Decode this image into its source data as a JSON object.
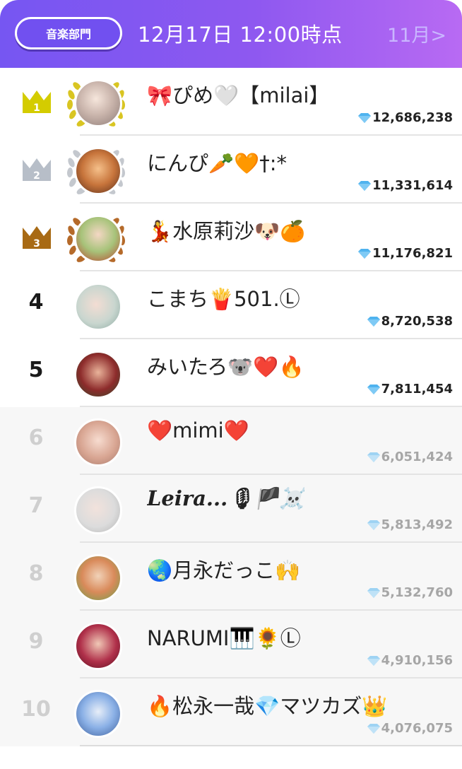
{
  "header": {
    "category_label": "音楽部門",
    "date_title": "12月17日 12:00時点",
    "month_link": "11月>"
  },
  "colors": {
    "header_gradient_start": "#7656f2",
    "header_gradient_end": "#b86af3",
    "gold": "#d4cc00",
    "silver": "#b7bec8",
    "bronze": "#a86a14",
    "gem": "#4fb3ef"
  },
  "rankings": [
    {
      "rank": "1",
      "name": "🎀ぴめ🤍【milai】",
      "score": "12,686,238",
      "badge": "gold-crown",
      "avatar": "avatar-photo"
    },
    {
      "rank": "2",
      "name": "にんぴ🥕🧡†:*",
      "score": "11,331,614",
      "badge": "silver-crown",
      "avatar": "avatar-photo"
    },
    {
      "rank": "3",
      "name": "💃水原莉沙🐶🍊",
      "score": "11,176,821",
      "badge": "bronze-crown",
      "avatar": "avatar-photo"
    },
    {
      "rank": "4",
      "name": "こまち🍟501.Ⓛ",
      "score": "8,720,538",
      "avatar": "avatar-photo"
    },
    {
      "rank": "5",
      "name": "みいたろ🐨❤️🔥",
      "score": "7,811,454",
      "avatar": "avatar-photo"
    },
    {
      "rank": "6",
      "name": "❤️mimi❤️",
      "score": "6,051,424",
      "avatar": "avatar-photo"
    },
    {
      "rank": "7",
      "name": "Leira...🎙🏴☠️",
      "score": "5,813,492",
      "avatar": "avatar-photo"
    },
    {
      "rank": "8",
      "name": "🌏月永だっこ🙌",
      "score": "5,132,760",
      "avatar": "avatar-photo"
    },
    {
      "rank": "9",
      "name": "NARUMI🎹🌻Ⓛ",
      "score": "4,910,156",
      "avatar": "avatar-photo"
    },
    {
      "rank": "10",
      "name": "🔥松永一哉💎マツカズ👑",
      "score": "4,076,075",
      "avatar": "avatar-photo"
    }
  ]
}
